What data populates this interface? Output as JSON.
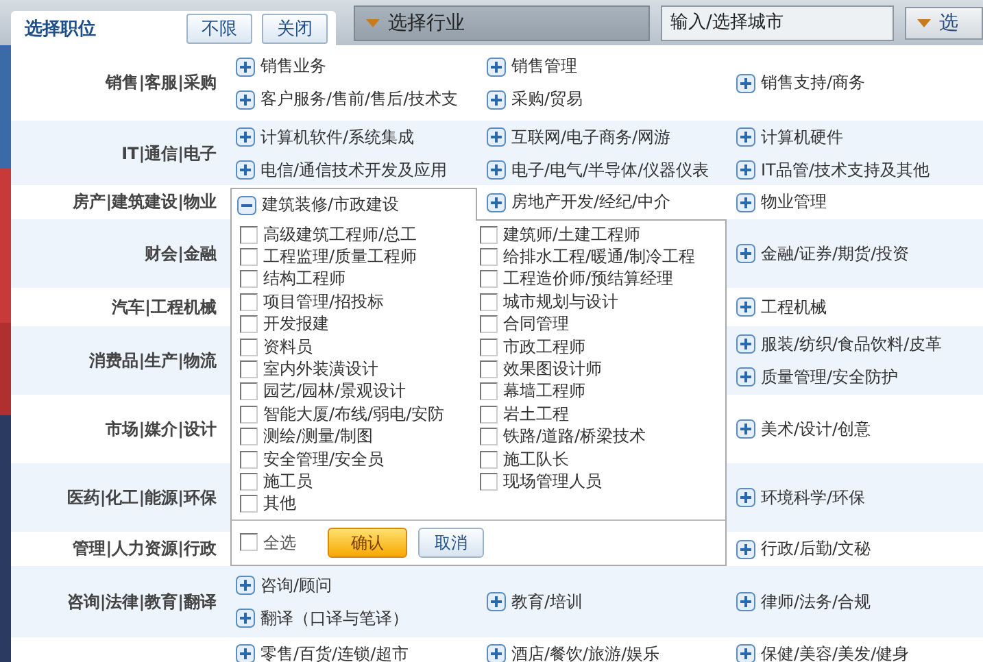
{
  "background": {
    "industry_dropdown": {
      "label": "选择行业"
    },
    "city_field": {
      "placeholder": "输入/选择城市"
    },
    "search_button": {
      "label": "选"
    }
  },
  "dialog": {
    "title": "选择职位",
    "buttons": [
      {
        "label": "不限"
      },
      {
        "label": "关闭"
      }
    ],
    "rows": [
      {
        "label": "销售|客服|采购",
        "col_1": [
          {
            "label": "销售业务",
            "expanded": false
          },
          {
            "label": "客户服务/售前/售后/技术支",
            "expanded": false
          }
        ],
        "col_2": [
          {
            "label": "销售管理",
            "expanded": false
          },
          {
            "label": "采购/贸易",
            "expanded": false
          }
        ],
        "col_3": [
          {
            "label": "销售支持/商务",
            "expanded": false
          }
        ]
      },
      {
        "label": "IT|通信|电子",
        "col_1": [
          {
            "label": "计算机软件/系统集成",
            "expanded": false
          },
          {
            "label": "电信/通信技术开发及应用",
            "expanded": false
          }
        ],
        "col_2": [
          {
            "label": "互联网/电子商务/网游",
            "expanded": false
          },
          {
            "label": "电子/电气/半导体/仪器仪表",
            "expanded": false
          }
        ],
        "col_3": [
          {
            "label": "计算机硬件",
            "expanded": false
          },
          {
            "label": "IT品管/技术支持及其他",
            "expanded": false
          }
        ]
      },
      {
        "label": "房产|建筑建设|物业",
        "col_2": [
          {
            "label": "房地产开发/经纪/中介",
            "expanded": false
          }
        ],
        "col_3": [
          {
            "label": "物业管理",
            "expanded": false
          }
        ]
      },
      {
        "label": "财会|金融",
        "col_3": [
          {
            "label": "金融/证券/期货/投资",
            "expanded": false
          }
        ]
      },
      {
        "label": "汽车|工程机械",
        "col_3": [
          {
            "label": "工程机械",
            "expanded": false
          }
        ]
      },
      {
        "label": "消费品|生产|物流",
        "col_3": [
          {
            "label": "服装/纺织/食品饮料/皮革",
            "expanded": false
          },
          {
            "label": "质量管理/安全防护",
            "expanded": false
          }
        ]
      },
      {
        "label": "市场|媒介|设计",
        "col_3": [
          {
            "label": "美术/设计/创意",
            "expanded": false
          }
        ]
      },
      {
        "label": "医药|化工|能源|环保",
        "col_3": [
          {
            "label": "环境科学/环保",
            "expanded": false
          }
        ]
      },
      {
        "label": "管理|人力资源|行政",
        "col_3": [
          {
            "label": "行政/后勤/文秘",
            "expanded": false
          }
        ]
      },
      {
        "label": "咨询|法律|教育|翻译",
        "col_1": [
          {
            "label": "咨询/顾问",
            "expanded": false
          },
          {
            "label": "翻译（口译与笔译）",
            "expanded": false
          }
        ],
        "col_2": [
          {
            "label": "教育/培训",
            "expanded": false
          }
        ],
        "col_3": [
          {
            "label": "律师/法务/合规",
            "expanded": false
          }
        ]
      },
      {
        "col_1": [
          {
            "label": "零售/百货/连锁/超市",
            "expanded": false
          }
        ],
        "col_2": [
          {
            "label": "酒店/餐饮/旅游/娱乐",
            "expanded": false
          }
        ],
        "col_3": [
          {
            "label": "保健/美容/美发/健身",
            "expanded": false
          }
        ]
      }
    ],
    "popup": {
      "category": {
        "label": "建筑装修/市政建设",
        "expanded": true
      },
      "options": [
        {
          "label": "高级建筑工程师/总工",
          "checked": false
        },
        {
          "label": "建筑师/土建工程师",
          "checked": false
        },
        {
          "label": "工程监理/质量工程师",
          "checked": false
        },
        {
          "label": "给排水工程/暖通/制冷工程",
          "checked": false
        },
        {
          "label": "结构工程师",
          "checked": false
        },
        {
          "label": "工程造价师/预结算经理",
          "checked": false
        },
        {
          "label": "项目管理/招投标",
          "checked": false
        },
        {
          "label": "城市规划与设计",
          "checked": false
        },
        {
          "label": "开发报建",
          "checked": false
        },
        {
          "label": "合同管理",
          "checked": false
        },
        {
          "label": "资料员",
          "checked": false
        },
        {
          "label": "市政工程师",
          "checked": false
        },
        {
          "label": "室内外装潢设计",
          "checked": false
        },
        {
          "label": "效果图设计师",
          "checked": false
        },
        {
          "label": "园艺/园林/景观设计",
          "checked": false
        },
        {
          "label": "幕墙工程师",
          "checked": false
        },
        {
          "label": "智能大厦/布线/弱电/安防",
          "checked": false
        },
        {
          "label": "岩土工程",
          "checked": false
        },
        {
          "label": "测绘/测量/制图",
          "checked": false
        },
        {
          "label": "铁路/道路/桥梁技术",
          "checked": false
        },
        {
          "label": "安全管理/安全员",
          "checked": false
        },
        {
          "label": "施工队长",
          "checked": false
        },
        {
          "label": "施工员",
          "checked": false
        },
        {
          "label": "现场管理人员",
          "checked": false
        },
        {
          "label": "其他",
          "checked": false
        }
      ],
      "select_all": {
        "label": "全选",
        "checked": false
      },
      "confirm": {
        "label": "确认"
      },
      "cancel": {
        "label": "取消"
      }
    }
  }
}
